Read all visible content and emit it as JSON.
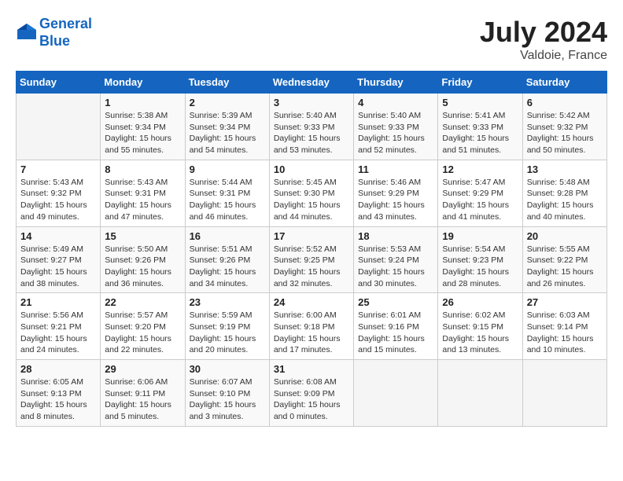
{
  "header": {
    "logo_line1": "General",
    "logo_line2": "Blue",
    "month": "July 2024",
    "location": "Valdoie, France"
  },
  "weekdays": [
    "Sunday",
    "Monday",
    "Tuesday",
    "Wednesday",
    "Thursday",
    "Friday",
    "Saturday"
  ],
  "weeks": [
    [
      {
        "day": "",
        "info": ""
      },
      {
        "day": "1",
        "info": "Sunrise: 5:38 AM\nSunset: 9:34 PM\nDaylight: 15 hours\nand 55 minutes."
      },
      {
        "day": "2",
        "info": "Sunrise: 5:39 AM\nSunset: 9:34 PM\nDaylight: 15 hours\nand 54 minutes."
      },
      {
        "day": "3",
        "info": "Sunrise: 5:40 AM\nSunset: 9:33 PM\nDaylight: 15 hours\nand 53 minutes."
      },
      {
        "day": "4",
        "info": "Sunrise: 5:40 AM\nSunset: 9:33 PM\nDaylight: 15 hours\nand 52 minutes."
      },
      {
        "day": "5",
        "info": "Sunrise: 5:41 AM\nSunset: 9:33 PM\nDaylight: 15 hours\nand 51 minutes."
      },
      {
        "day": "6",
        "info": "Sunrise: 5:42 AM\nSunset: 9:32 PM\nDaylight: 15 hours\nand 50 minutes."
      }
    ],
    [
      {
        "day": "7",
        "info": "Sunrise: 5:43 AM\nSunset: 9:32 PM\nDaylight: 15 hours\nand 49 minutes."
      },
      {
        "day": "8",
        "info": "Sunrise: 5:43 AM\nSunset: 9:31 PM\nDaylight: 15 hours\nand 47 minutes."
      },
      {
        "day": "9",
        "info": "Sunrise: 5:44 AM\nSunset: 9:31 PM\nDaylight: 15 hours\nand 46 minutes."
      },
      {
        "day": "10",
        "info": "Sunrise: 5:45 AM\nSunset: 9:30 PM\nDaylight: 15 hours\nand 44 minutes."
      },
      {
        "day": "11",
        "info": "Sunrise: 5:46 AM\nSunset: 9:29 PM\nDaylight: 15 hours\nand 43 minutes."
      },
      {
        "day": "12",
        "info": "Sunrise: 5:47 AM\nSunset: 9:29 PM\nDaylight: 15 hours\nand 41 minutes."
      },
      {
        "day": "13",
        "info": "Sunrise: 5:48 AM\nSunset: 9:28 PM\nDaylight: 15 hours\nand 40 minutes."
      }
    ],
    [
      {
        "day": "14",
        "info": "Sunrise: 5:49 AM\nSunset: 9:27 PM\nDaylight: 15 hours\nand 38 minutes."
      },
      {
        "day": "15",
        "info": "Sunrise: 5:50 AM\nSunset: 9:26 PM\nDaylight: 15 hours\nand 36 minutes."
      },
      {
        "day": "16",
        "info": "Sunrise: 5:51 AM\nSunset: 9:26 PM\nDaylight: 15 hours\nand 34 minutes."
      },
      {
        "day": "17",
        "info": "Sunrise: 5:52 AM\nSunset: 9:25 PM\nDaylight: 15 hours\nand 32 minutes."
      },
      {
        "day": "18",
        "info": "Sunrise: 5:53 AM\nSunset: 9:24 PM\nDaylight: 15 hours\nand 30 minutes."
      },
      {
        "day": "19",
        "info": "Sunrise: 5:54 AM\nSunset: 9:23 PM\nDaylight: 15 hours\nand 28 minutes."
      },
      {
        "day": "20",
        "info": "Sunrise: 5:55 AM\nSunset: 9:22 PM\nDaylight: 15 hours\nand 26 minutes."
      }
    ],
    [
      {
        "day": "21",
        "info": "Sunrise: 5:56 AM\nSunset: 9:21 PM\nDaylight: 15 hours\nand 24 minutes."
      },
      {
        "day": "22",
        "info": "Sunrise: 5:57 AM\nSunset: 9:20 PM\nDaylight: 15 hours\nand 22 minutes."
      },
      {
        "day": "23",
        "info": "Sunrise: 5:59 AM\nSunset: 9:19 PM\nDaylight: 15 hours\nand 20 minutes."
      },
      {
        "day": "24",
        "info": "Sunrise: 6:00 AM\nSunset: 9:18 PM\nDaylight: 15 hours\nand 17 minutes."
      },
      {
        "day": "25",
        "info": "Sunrise: 6:01 AM\nSunset: 9:16 PM\nDaylight: 15 hours\nand 15 minutes."
      },
      {
        "day": "26",
        "info": "Sunrise: 6:02 AM\nSunset: 9:15 PM\nDaylight: 15 hours\nand 13 minutes."
      },
      {
        "day": "27",
        "info": "Sunrise: 6:03 AM\nSunset: 9:14 PM\nDaylight: 15 hours\nand 10 minutes."
      }
    ],
    [
      {
        "day": "28",
        "info": "Sunrise: 6:05 AM\nSunset: 9:13 PM\nDaylight: 15 hours\nand 8 minutes."
      },
      {
        "day": "29",
        "info": "Sunrise: 6:06 AM\nSunset: 9:11 PM\nDaylight: 15 hours\nand 5 minutes."
      },
      {
        "day": "30",
        "info": "Sunrise: 6:07 AM\nSunset: 9:10 PM\nDaylight: 15 hours\nand 3 minutes."
      },
      {
        "day": "31",
        "info": "Sunrise: 6:08 AM\nSunset: 9:09 PM\nDaylight: 15 hours\nand 0 minutes."
      },
      {
        "day": "",
        "info": ""
      },
      {
        "day": "",
        "info": ""
      },
      {
        "day": "",
        "info": ""
      }
    ]
  ]
}
